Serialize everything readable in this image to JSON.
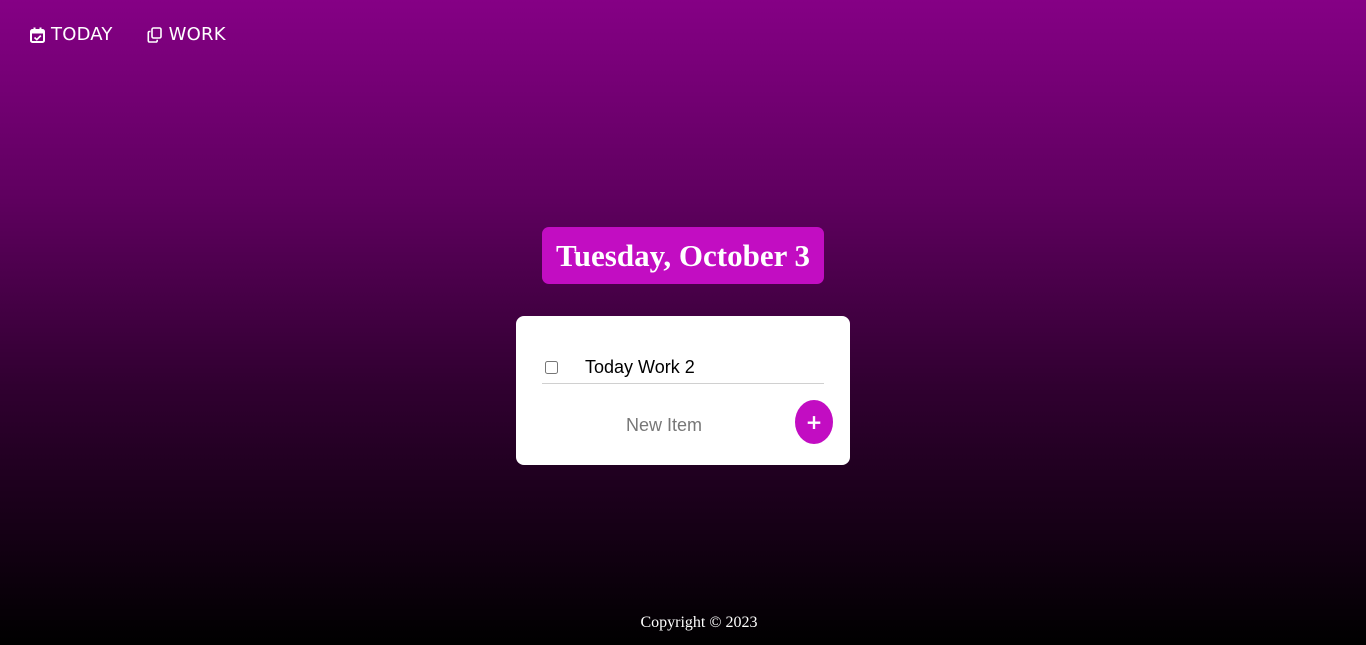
{
  "nav": {
    "items": [
      {
        "label": "TODAY",
        "icon": "calendar-check-icon"
      },
      {
        "label": "WORK",
        "icon": "copy-icon"
      }
    ]
  },
  "main": {
    "date_heading": "Tuesday, October 3",
    "items": [
      {
        "text": "Today Work 2",
        "checked": false
      }
    ],
    "new_item": {
      "placeholder": "New Item",
      "add_label": "+"
    }
  },
  "footer": {
    "copyright": "Copyright © 2023"
  },
  "colors": {
    "accent": "#c20dc2",
    "background_top": "#850085",
    "background_bottom": "#000000",
    "card": "#ffffff"
  }
}
